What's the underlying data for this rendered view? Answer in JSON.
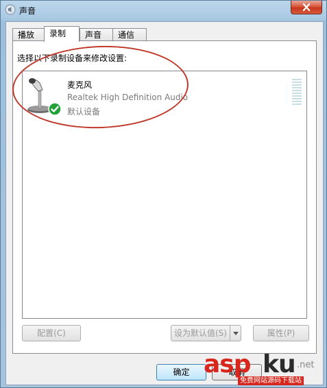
{
  "window": {
    "title": "声音"
  },
  "tabs": [
    {
      "label": "播放"
    },
    {
      "label": "录制"
    },
    {
      "label": "声音"
    },
    {
      "label": "通信"
    }
  ],
  "panel": {
    "instruction": "选择以下录制设备来修改设置:",
    "devices": [
      {
        "name": "麦克风",
        "driver": "Realtek High Definition Audio",
        "status": "默认设备",
        "icon": "microphone-icon",
        "status_icon": "default-check-icon"
      }
    ]
  },
  "buttons": {
    "configure": "配置(C)",
    "set_default": "设为默认值(S)",
    "properties": "属性(P)",
    "ok": "确定",
    "cancel": "取消"
  },
  "watermark": {
    "asp": "asp",
    "ku": "ku",
    "net": ".net",
    "sub": "免费网站源码下载站"
  },
  "colors": {
    "annotation": "#c0392b",
    "check": "#22a33a"
  }
}
